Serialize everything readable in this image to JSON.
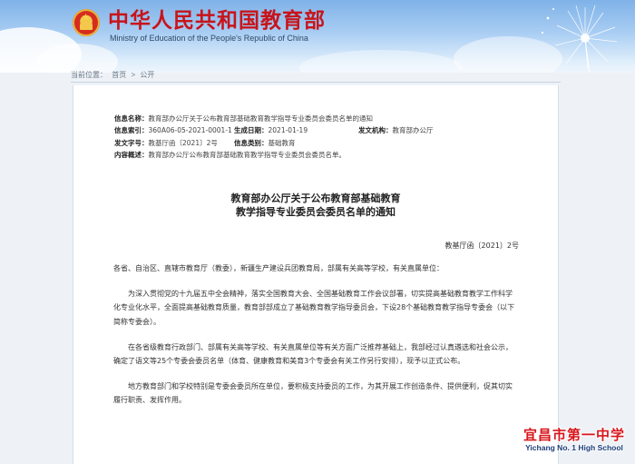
{
  "header": {
    "title": "中华人民共和国教育部",
    "subtitle": "Ministry of Education of the People's Republic of China"
  },
  "breadcrumb": {
    "location_label": "当前位置：",
    "items": [
      "首页",
      "公开"
    ],
    "separator": ">"
  },
  "meta": {
    "info_name_label": "信息名称：",
    "info_name": "教育部办公厅关于公布教育部基础教育教学指导专业委员会委员名单的通知",
    "index_label": "信息索引：",
    "index": "360A06-05-2021-0001-1",
    "date_label": "生成日期：",
    "date": "2021-01-19",
    "issuer_label": "发文机构：",
    "issuer": "教育部办公厅",
    "doc_no_label": "发文字号：",
    "doc_no": "教基厅函〔2021〕2号",
    "category_label": "信息类别：",
    "category": "基础教育",
    "summary_label": "内容概述：",
    "summary": "教育部办公厅公布教育部基础教育教学指导专业委员会委员名单。"
  },
  "document": {
    "title_line1": "教育部办公厅关于公布教育部基础教育",
    "title_line2": "教学指导专业委员会委员名单的通知",
    "number": "教基厅函〔2021〕2号",
    "salutation": "各省、自治区、直辖市教育厅（教委），新疆生产建设兵团教育局，部属有关高等学校，有关直属单位：",
    "paragraphs": [
      "为深入贯彻党的十九届五中全会精神，落实全国教育大会、全国基础教育工作会议部署，切实提高基础教育教学工作科学化专业化水平，全面提高基础教育质量，教育部部成立了基础教育教学指导委员会，下设28个基础教育教学指导专委会（以下简称专委会）。",
      "在各省级教育行政部门、部属有关高等学校、有关直属单位等有关方面广泛推荐基础上，我部经过认真遴选和社会公示，确定了语文等25个专委会委员名单（体育、健康教育和美育3个专委会有关工作另行安排），现予以正式公布。",
      "地方教育部门和学校特别是专委会委员所在单位，要积极支持委员的工作，为其开展工作创造条件、提供便利，促其切实履行职责、发挥作用。"
    ]
  },
  "watermark": {
    "name_cn": "宜昌市第一中学",
    "name_en": "Yichang No. 1 High School"
  }
}
